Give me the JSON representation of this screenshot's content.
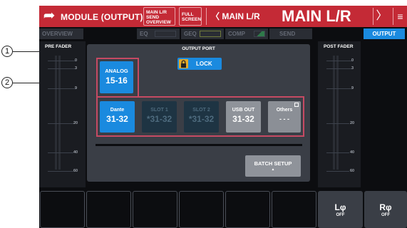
{
  "header": {
    "module_title": "MODULE (OUTPUT)",
    "send_overview_label_1": "MAIN L/R",
    "send_overview_label_2": "SEND",
    "send_overview_label_3": "OVERVIEW",
    "full_screen_label_1": "FULL",
    "full_screen_label_2": "SCREEN",
    "nav_prev_label": "MAIN L/R",
    "channel_title": "MAIN L/R",
    "back_glyph": "➦",
    "prev_glyph": "〈",
    "next_glyph": "〉",
    "menu_glyph": "≡"
  },
  "tabs": {
    "overview": "OVERVIEW",
    "eq": "EQ",
    "geq": "GEQ",
    "comp": "COMP",
    "send": "SEND",
    "output": "OUTPUT"
  },
  "pre_fader": {
    "label": "PRE FADER",
    "scale": [
      "0",
      "3",
      "9",
      "20",
      "40",
      "60"
    ]
  },
  "post_fader": {
    "label": "POST FADER",
    "scale": [
      "0",
      "3",
      "9",
      "20",
      "40",
      "60"
    ]
  },
  "output_port": {
    "title": "OUTPUT PORT",
    "lock_label": "LOCK",
    "analog": {
      "line1": "ANALOG",
      "line2": "15-16"
    },
    "dante": {
      "line1": "Dante",
      "line2": "31-32"
    },
    "slot1": {
      "line1": "SLOT 1",
      "line2": "*31-32"
    },
    "slot2": {
      "line1": "SLOT 2",
      "line2": "*31-32"
    },
    "usb_out": {
      "line1": "USB OUT",
      "line2": "31-32"
    },
    "others": {
      "line1": "Others",
      "line2": "- - -"
    },
    "batch_setup": "BATCH SETUP",
    "batch_arrow": "▲"
  },
  "bottom": {
    "l_phase": {
      "label": "Lφ",
      "state": "OFF"
    },
    "r_phase": {
      "label": "Rφ",
      "state": "OFF"
    }
  },
  "callouts": {
    "one": "1",
    "two": "2"
  },
  "colors": {
    "brand_red": "#c42a36",
    "accent_blue": "#1a8adf",
    "highlight_frame": "#c64a63"
  }
}
